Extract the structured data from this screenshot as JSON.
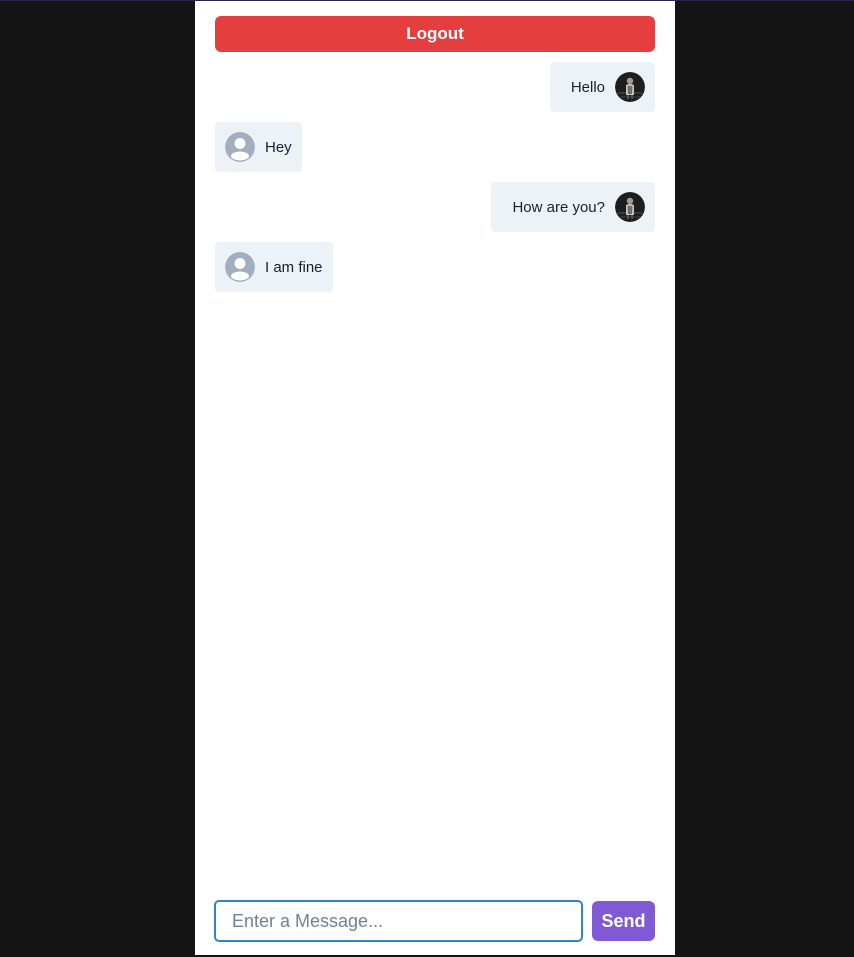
{
  "header": {
    "logout_label": "Logout"
  },
  "messages": [
    {
      "direction": "sent",
      "text": "Hello",
      "avatar": "user-photo-avatar"
    },
    {
      "direction": "received",
      "text": "Hey",
      "avatar": "default-user-icon"
    },
    {
      "direction": "sent",
      "text": "How are you?",
      "avatar": "user-photo-avatar"
    },
    {
      "direction": "received",
      "text": "I am fine",
      "avatar": "default-user-icon"
    }
  ],
  "composer": {
    "placeholder": "Enter a Message...",
    "value": "",
    "send_label": "Send"
  },
  "colors": {
    "logout": "#e53e3e",
    "send": "#805ad5",
    "bubble": "#edf2f7",
    "input_border": "#3182ce",
    "page_background": "#141414"
  }
}
